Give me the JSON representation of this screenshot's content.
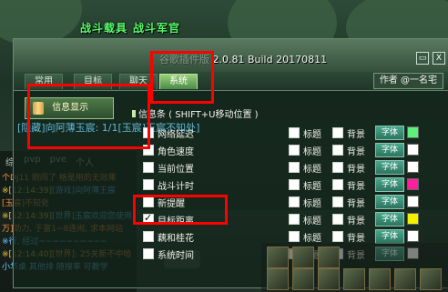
{
  "scene": {
    "char_titles": [
      "战斗载具",
      "战斗军官"
    ],
    "left_icon_label": "番"
  },
  "chat": {
    "tabs": [
      "综",
      "pvp",
      "pve",
      "个人"
    ],
    "lines": [
      {
        "time": "",
        "text": "个DJ11 刚闯了 格是用的无效果"
      },
      {
        "time": "※[12:14:39]",
        "text": "[游戏]向阿薄王宸"
      },
      {
        "time": "",
        "text": "[玉宸]不知处"
      },
      {
        "time": "※[12:14:39]",
        "text": "[世界]玉宸欢迎您使用"
      },
      {
        "time": "",
        "text": "万]助力, 于富1~8连闹, 求本网站"
      },
      {
        "time": "",
        "text": "※行, 经过~~~~~~~~~~"
      },
      {
        "time": "※[12:14:40]",
        "text": "[世界]: 25关新不中哈"
      },
      {
        "time": "",
        "text": "小华桌 其他排 随搜率 可教学"
      }
    ]
  },
  "window": {
    "title": "2.0.81 Build 20170811",
    "title_prefix": "谷歌插件版",
    "min_label": "▭",
    "close_label": "X",
    "tabs": [
      "常用",
      "目标",
      "聊天",
      "系统"
    ],
    "active_tab": "系统",
    "author_button": "作者 @一名宅"
  },
  "side_menu": {
    "item": "信息显示"
  },
  "notice_line": "[隐藏]向阿薄玉宸: 1/1[玉宸]玉宸不知处]",
  "info_section": {
    "title": "信息条 ( SHIFT+U移动位置 )",
    "title_label": "标题",
    "bg_label": "背景",
    "font_label": "字体",
    "rows": [
      {
        "label": "网络延迟",
        "checked": false,
        "color": "#5ef07a"
      },
      {
        "label": "角色速度",
        "checked": false,
        "color": "#ffffff"
      },
      {
        "label": "当前位置",
        "checked": false,
        "color": "#ffffff"
      },
      {
        "label": "战斗计时",
        "checked": false,
        "color": "#ff1f9e"
      },
      {
        "label": "新提醒",
        "checked": false,
        "color": "#ffffff"
      },
      {
        "label": "目标距离",
        "checked": true,
        "color": "#f4f000"
      },
      {
        "label": "藕和桂花",
        "checked": false,
        "color": "#ffffff"
      },
      {
        "label": "系统时间",
        "checked": false,
        "color": "#ffffff"
      }
    ]
  },
  "colors": {
    "active_tab": "#6aa85a",
    "highlight": "#ff0000",
    "font_button": "#3b8f78"
  }
}
